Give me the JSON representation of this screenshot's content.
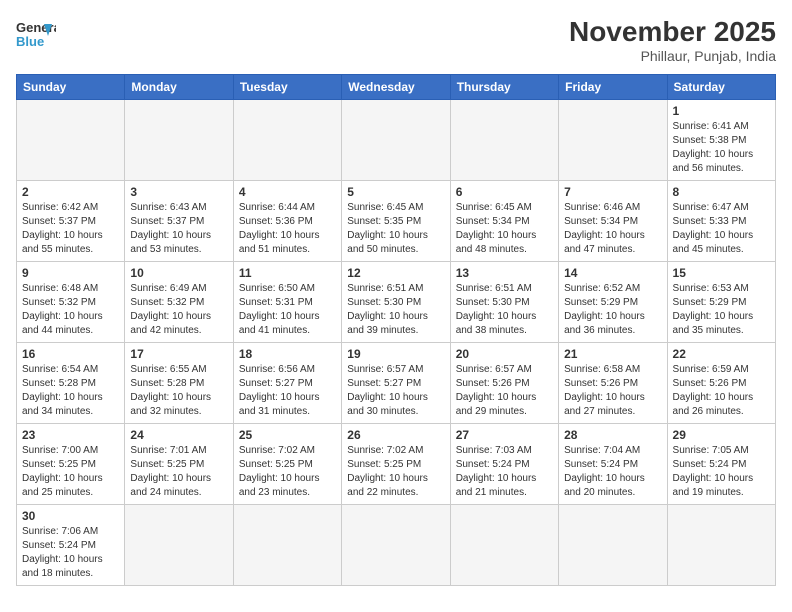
{
  "header": {
    "logo_general": "General",
    "logo_blue": "Blue",
    "month_year": "November 2025",
    "location": "Phillaur, Punjab, India"
  },
  "days_of_week": [
    "Sunday",
    "Monday",
    "Tuesday",
    "Wednesday",
    "Thursday",
    "Friday",
    "Saturday"
  ],
  "weeks": [
    [
      {
        "day": "",
        "info": ""
      },
      {
        "day": "",
        "info": ""
      },
      {
        "day": "",
        "info": ""
      },
      {
        "day": "",
        "info": ""
      },
      {
        "day": "",
        "info": ""
      },
      {
        "day": "",
        "info": ""
      },
      {
        "day": "1",
        "info": "Sunrise: 6:41 AM\nSunset: 5:38 PM\nDaylight: 10 hours and 56 minutes."
      }
    ],
    [
      {
        "day": "2",
        "info": "Sunrise: 6:42 AM\nSunset: 5:37 PM\nDaylight: 10 hours and 55 minutes."
      },
      {
        "day": "3",
        "info": "Sunrise: 6:43 AM\nSunset: 5:37 PM\nDaylight: 10 hours and 53 minutes."
      },
      {
        "day": "4",
        "info": "Sunrise: 6:44 AM\nSunset: 5:36 PM\nDaylight: 10 hours and 51 minutes."
      },
      {
        "day": "5",
        "info": "Sunrise: 6:45 AM\nSunset: 5:35 PM\nDaylight: 10 hours and 50 minutes."
      },
      {
        "day": "6",
        "info": "Sunrise: 6:45 AM\nSunset: 5:34 PM\nDaylight: 10 hours and 48 minutes."
      },
      {
        "day": "7",
        "info": "Sunrise: 6:46 AM\nSunset: 5:34 PM\nDaylight: 10 hours and 47 minutes."
      },
      {
        "day": "8",
        "info": "Sunrise: 6:47 AM\nSunset: 5:33 PM\nDaylight: 10 hours and 45 minutes."
      }
    ],
    [
      {
        "day": "9",
        "info": "Sunrise: 6:48 AM\nSunset: 5:32 PM\nDaylight: 10 hours and 44 minutes."
      },
      {
        "day": "10",
        "info": "Sunrise: 6:49 AM\nSunset: 5:32 PM\nDaylight: 10 hours and 42 minutes."
      },
      {
        "day": "11",
        "info": "Sunrise: 6:50 AM\nSunset: 5:31 PM\nDaylight: 10 hours and 41 minutes."
      },
      {
        "day": "12",
        "info": "Sunrise: 6:51 AM\nSunset: 5:30 PM\nDaylight: 10 hours and 39 minutes."
      },
      {
        "day": "13",
        "info": "Sunrise: 6:51 AM\nSunset: 5:30 PM\nDaylight: 10 hours and 38 minutes."
      },
      {
        "day": "14",
        "info": "Sunrise: 6:52 AM\nSunset: 5:29 PM\nDaylight: 10 hours and 36 minutes."
      },
      {
        "day": "15",
        "info": "Sunrise: 6:53 AM\nSunset: 5:29 PM\nDaylight: 10 hours and 35 minutes."
      }
    ],
    [
      {
        "day": "16",
        "info": "Sunrise: 6:54 AM\nSunset: 5:28 PM\nDaylight: 10 hours and 34 minutes."
      },
      {
        "day": "17",
        "info": "Sunrise: 6:55 AM\nSunset: 5:28 PM\nDaylight: 10 hours and 32 minutes."
      },
      {
        "day": "18",
        "info": "Sunrise: 6:56 AM\nSunset: 5:27 PM\nDaylight: 10 hours and 31 minutes."
      },
      {
        "day": "19",
        "info": "Sunrise: 6:57 AM\nSunset: 5:27 PM\nDaylight: 10 hours and 30 minutes."
      },
      {
        "day": "20",
        "info": "Sunrise: 6:57 AM\nSunset: 5:26 PM\nDaylight: 10 hours and 29 minutes."
      },
      {
        "day": "21",
        "info": "Sunrise: 6:58 AM\nSunset: 5:26 PM\nDaylight: 10 hours and 27 minutes."
      },
      {
        "day": "22",
        "info": "Sunrise: 6:59 AM\nSunset: 5:26 PM\nDaylight: 10 hours and 26 minutes."
      }
    ],
    [
      {
        "day": "23",
        "info": "Sunrise: 7:00 AM\nSunset: 5:25 PM\nDaylight: 10 hours and 25 minutes."
      },
      {
        "day": "24",
        "info": "Sunrise: 7:01 AM\nSunset: 5:25 PM\nDaylight: 10 hours and 24 minutes."
      },
      {
        "day": "25",
        "info": "Sunrise: 7:02 AM\nSunset: 5:25 PM\nDaylight: 10 hours and 23 minutes."
      },
      {
        "day": "26",
        "info": "Sunrise: 7:02 AM\nSunset: 5:25 PM\nDaylight: 10 hours and 22 minutes."
      },
      {
        "day": "27",
        "info": "Sunrise: 7:03 AM\nSunset: 5:24 PM\nDaylight: 10 hours and 21 minutes."
      },
      {
        "day": "28",
        "info": "Sunrise: 7:04 AM\nSunset: 5:24 PM\nDaylight: 10 hours and 20 minutes."
      },
      {
        "day": "29",
        "info": "Sunrise: 7:05 AM\nSunset: 5:24 PM\nDaylight: 10 hours and 19 minutes."
      }
    ],
    [
      {
        "day": "30",
        "info": "Sunrise: 7:06 AM\nSunset: 5:24 PM\nDaylight: 10 hours and 18 minutes."
      },
      {
        "day": "",
        "info": ""
      },
      {
        "day": "",
        "info": ""
      },
      {
        "day": "",
        "info": ""
      },
      {
        "day": "",
        "info": ""
      },
      {
        "day": "",
        "info": ""
      },
      {
        "day": "",
        "info": ""
      }
    ]
  ]
}
